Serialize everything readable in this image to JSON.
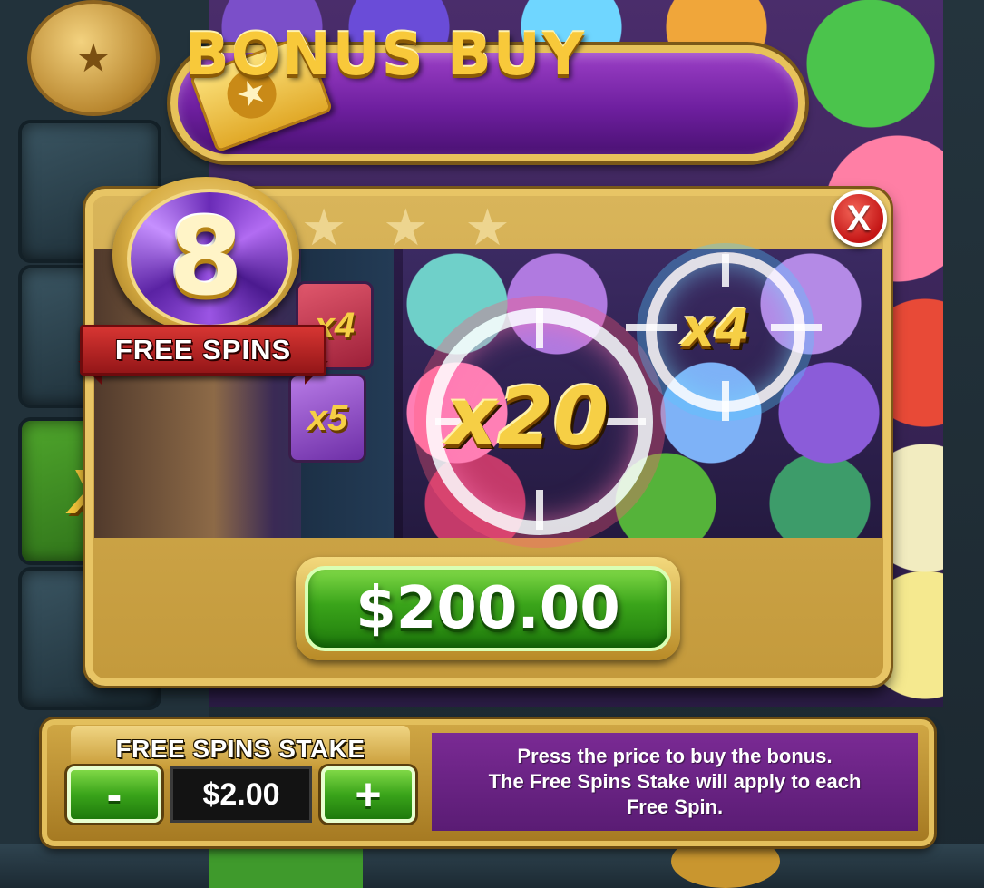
{
  "banner": {
    "title": "BONUS BUY"
  },
  "bonus": {
    "free_spins_count": "8",
    "free_spins_label": "FREE SPINS",
    "preview_multipliers": [
      "x4",
      "x5",
      "x20",
      "x4"
    ],
    "price": "$200.00"
  },
  "close": {
    "symbol": "X"
  },
  "stake": {
    "title": "FREE SPINS STAKE",
    "value": "$2.00",
    "minus_symbol": "-",
    "plus_symbol": "+"
  },
  "info": {
    "lines": [
      "Press the price to buy the bonus.",
      "The Free Spins Stake will apply to each",
      "Free Spin."
    ]
  },
  "background": {
    "reel_multiplier": "X"
  },
  "colors": {
    "banner_purple": "#6e1f9f",
    "gold_frame": "#e8c565",
    "price_green": "#3aa41a",
    "close_red": "#c41616",
    "info_purple": "#6a2185"
  }
}
